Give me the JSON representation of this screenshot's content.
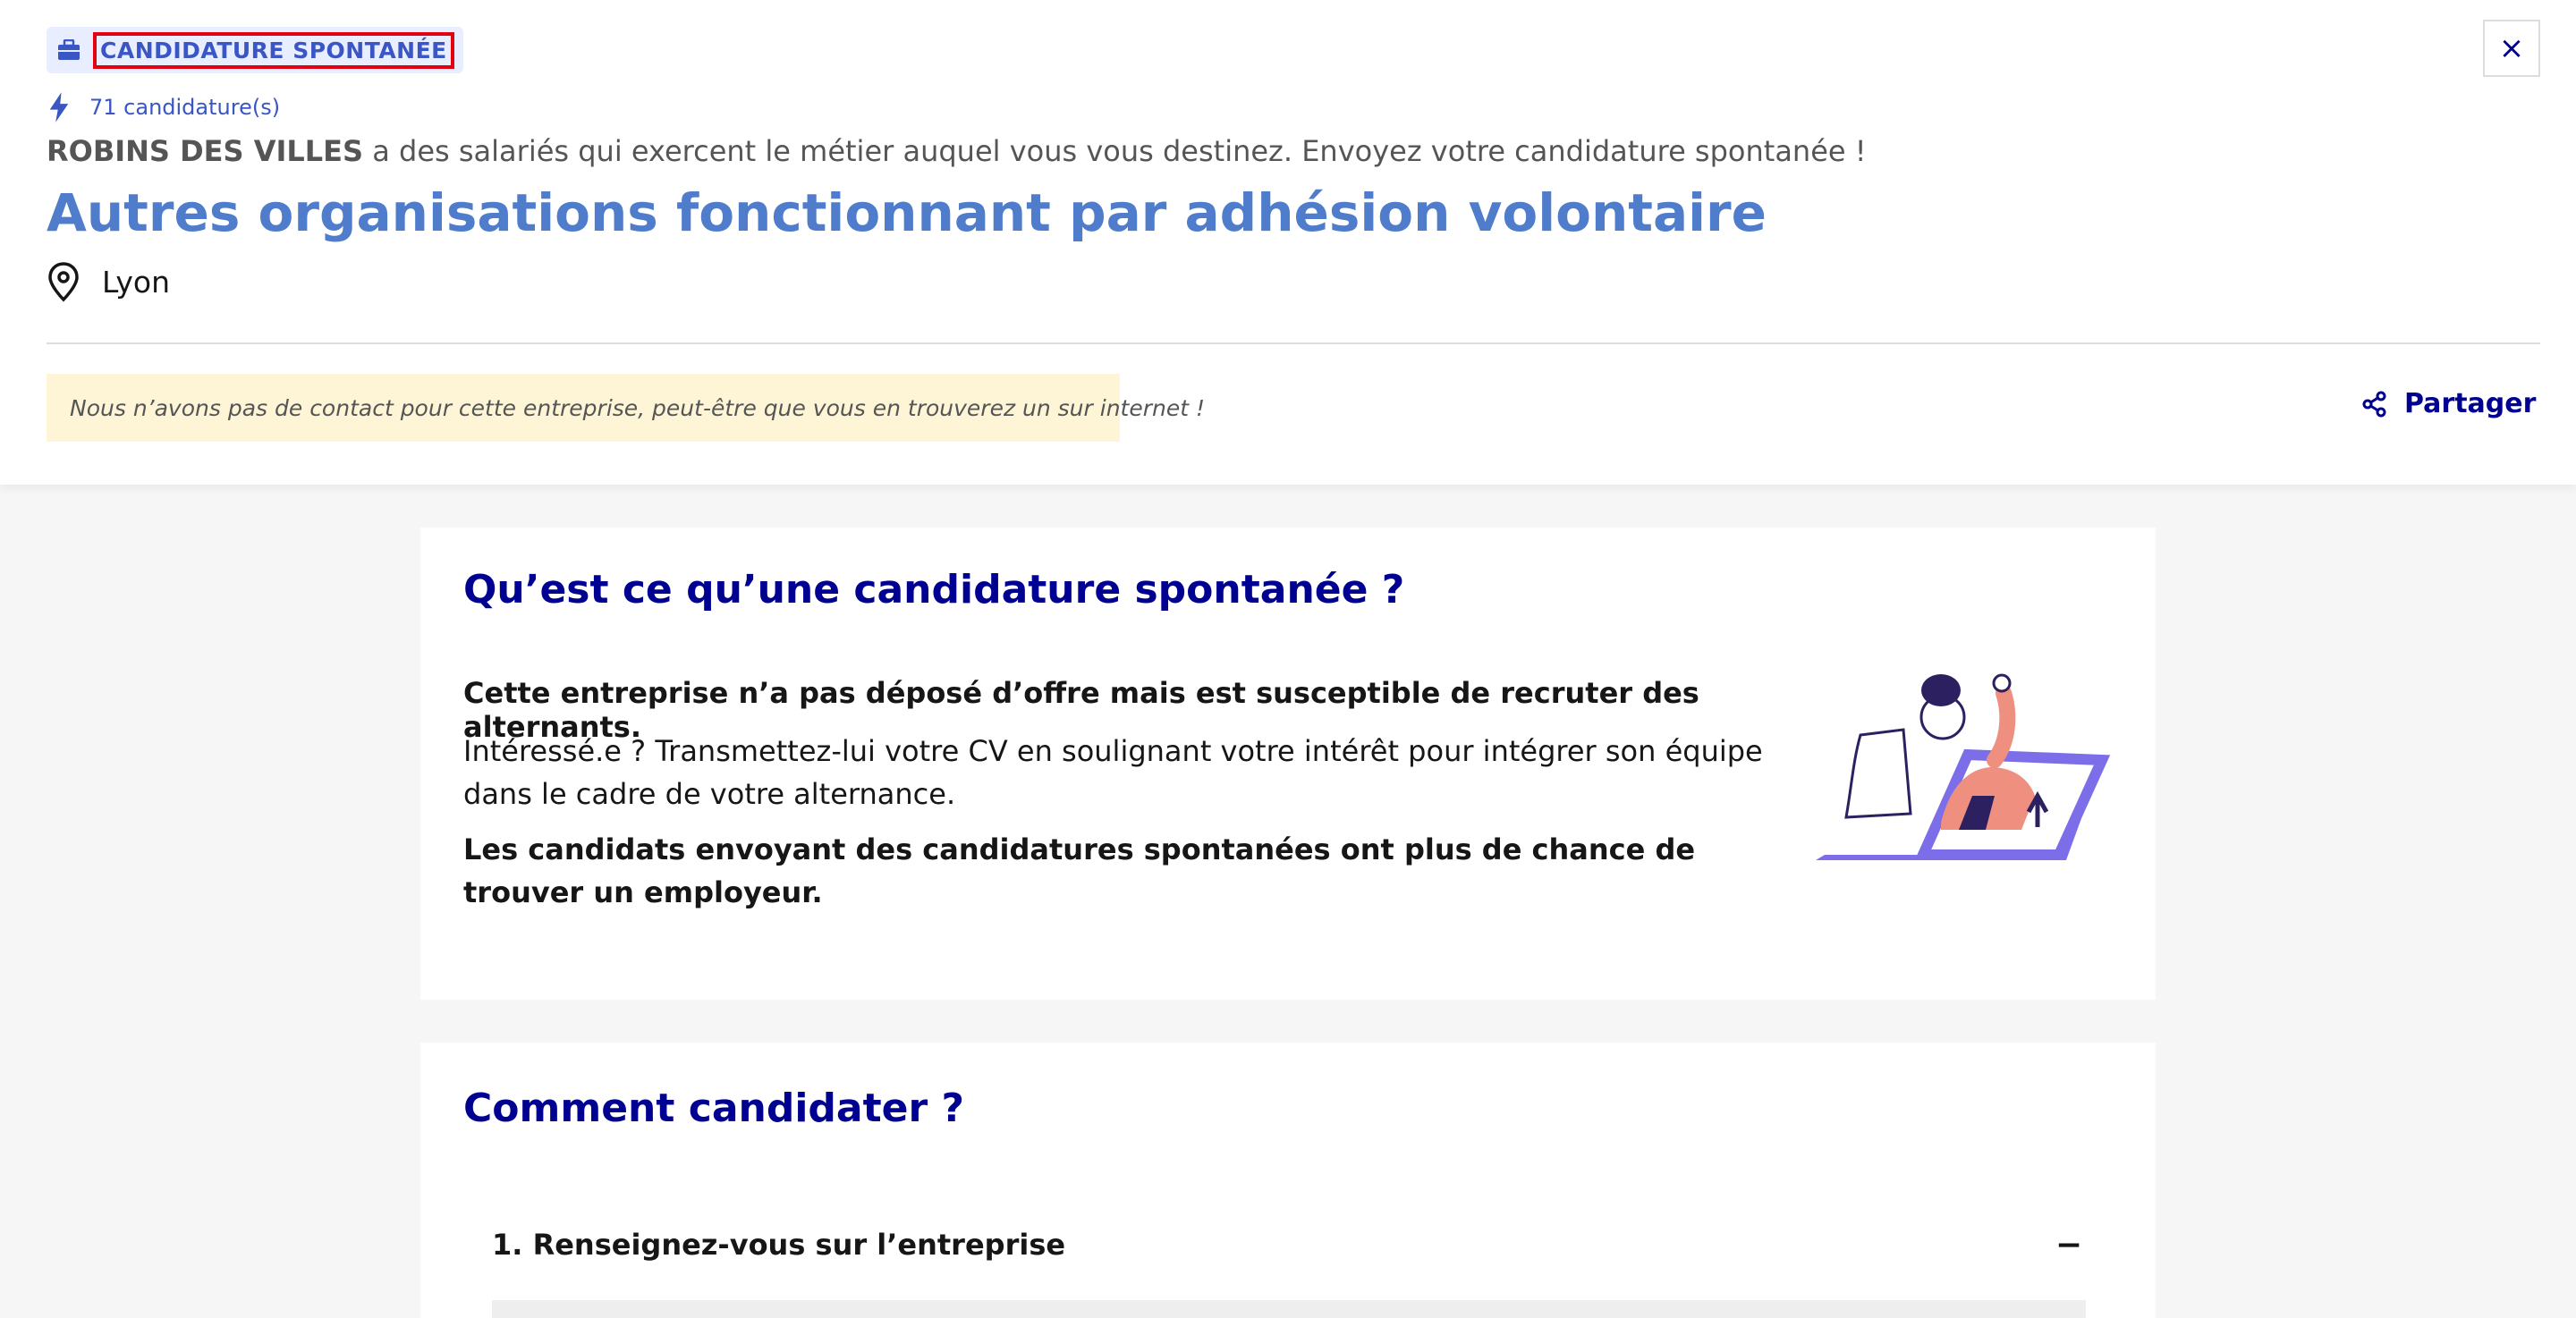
{
  "tag": {
    "label": "CANDIDATURE SPONTANÉE",
    "icon": "briefcase-icon"
  },
  "applications": {
    "count_text": "71 candidature(s)",
    "icon": "bolt-icon"
  },
  "company": {
    "name": "ROBINS DES VILLES",
    "description": "a des salariés qui exercent le métier auquel vous vous destinez. Envoyez votre candidature spontanée !"
  },
  "job_title": "Autres organisations fonctionnant par adhésion volontaire",
  "location": {
    "city": "Lyon",
    "icon": "location-pin-icon"
  },
  "notice": {
    "text": "Nous n’avons pas de contact pour cette entreprise, peut-être que vous en trouverez un sur internet !",
    "icon": "detective-icon"
  },
  "share": {
    "label": "Partager",
    "icon": "share-icon"
  },
  "close": {
    "label": "×"
  },
  "section_what": {
    "title": "Qu’est ce qu’une candidature spontanée ?",
    "p1": "Cette entreprise n’a pas déposé d’offre mais est susceptible de recruter des alternants.",
    "p2": "Intéressé.e ? Transmettez-lui votre CV en soulignant votre intérêt pour intégrer son équipe dans le cadre de votre alternance.",
    "p3": "Les candidats envoyant des candidatures spontanées ont plus de chance de trouver un employeur."
  },
  "section_how": {
    "title": "Comment candidater ?",
    "steps": [
      {
        "label": "1. Renseignez-vous sur l’entreprise",
        "toggle": "−"
      }
    ]
  },
  "colors": {
    "accent": "#000091",
    "title": "#4f7ccb",
    "tag_bg": "#e8edff",
    "notice_bg": "#fdf5d6",
    "highlight": "#e1000f"
  }
}
